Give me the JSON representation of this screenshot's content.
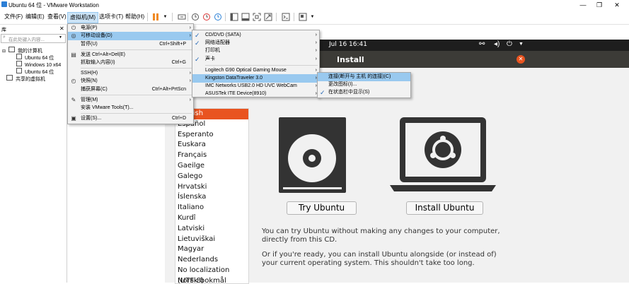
{
  "window": {
    "title": "Ubuntu 64 位 - VMware Workstation",
    "min": "—",
    "max": "❐",
    "close": "✕"
  },
  "menubar": [
    "文件(F)",
    "编辑(E)",
    "查看(V)",
    "虚拟机(M)",
    "选项卡(T)",
    "帮助(H)"
  ],
  "library": {
    "title": "库",
    "search_placeholder": "在此处键入内容...",
    "my_computer": "我的计算机",
    "vms": [
      "Ubuntu 64 位",
      "Windows 10 x64",
      "Ubuntu 64 位"
    ],
    "shared": "共享的虚拟机"
  },
  "vm_menu": [
    {
      "label": "电源(P)",
      "shortcut": "",
      "submenu": true
    },
    {
      "label": "可移动设备(D)",
      "shortcut": "",
      "submenu": true,
      "highlight": true
    },
    {
      "label": "暂停(U)",
      "shortcut": "Ctrl+Shift+P",
      "submenu": false
    },
    {
      "label": "发送 Ctrl+Alt+Del(E)",
      "shortcut": "",
      "submenu": false
    },
    {
      "label": "抓取输入内容(I)",
      "shortcut": "Ctrl+G",
      "submenu": false
    },
    {
      "label": "SSH(H)",
      "shortcut": "",
      "submenu": true
    },
    {
      "label": "快照(N)",
      "shortcut": "",
      "submenu": true
    },
    {
      "label": "捕获屏幕(C)",
      "shortcut": "Ctrl+Alt+PrtScn",
      "submenu": false
    },
    {
      "label": "管理(M)",
      "shortcut": "",
      "submenu": true
    },
    {
      "label": "安装 VMware Tools(T)...",
      "shortcut": "",
      "submenu": false
    },
    {
      "label": "设置(S)...",
      "shortcut": "Ctrl+D",
      "submenu": false
    }
  ],
  "devices_menu": [
    {
      "label": "CD/DVD (SATA)",
      "checked": true
    },
    {
      "label": "网络适配器",
      "checked": true
    },
    {
      "label": "打印机",
      "checked": false
    },
    {
      "label": "声卡",
      "checked": true
    },
    {
      "label": "Logitech G90 Optical Gaming Mouse",
      "checked": false
    },
    {
      "label": "Kingston DataTraveler 3.0",
      "checked": false,
      "highlight": true
    },
    {
      "label": "IMC Networks USB2.0 HD UVC WebCam",
      "checked": false
    },
    {
      "label": "ASUSTek ITE Device(8910)",
      "checked": false
    }
  ],
  "usb_menu": [
    {
      "label": "连接(断开与 主机 的连接)(C)",
      "checked": false,
      "highlight": true
    },
    {
      "label": "更改图标(I)...",
      "checked": false
    },
    {
      "label": "在状态栏中显示(S)",
      "checked": true
    }
  ],
  "ubuntu": {
    "clock": "Jul 16  16:41",
    "header": "Install",
    "languages": [
      "English",
      "Español",
      "Esperanto",
      "Euskara",
      "Français",
      "Gaeilge",
      "Galego",
      "Hrvatski",
      "Íslenska",
      "Italiano",
      "Kurdî",
      "Latviski",
      "Lietuviškai",
      "Magyar",
      "Nederlands",
      "No localization (UTF-8)",
      "Norsk bokmål"
    ],
    "try_label": "Try Ubuntu",
    "install_label": "Install Ubuntu",
    "para1": "You can try Ubuntu without making any changes to your computer, directly from this CD.",
    "para2": "Or if you're ready, you can install Ubuntu alongside (or instead of) your current operating system.  This shouldn't take too long.",
    "accent": "#e95420"
  }
}
